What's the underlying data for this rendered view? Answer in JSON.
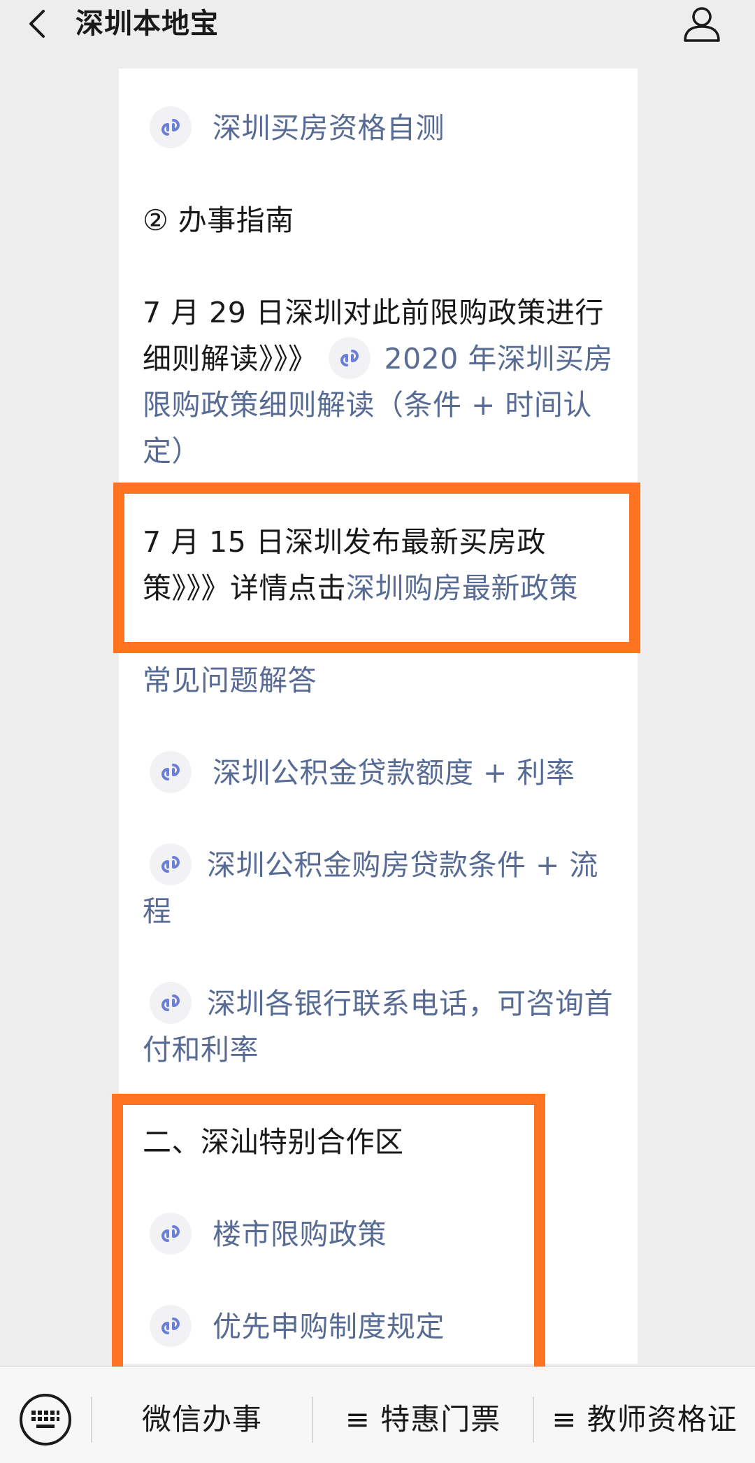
{
  "navbar": {
    "title": "深圳本地宝",
    "back_icon": "back-chevron-icon",
    "profile_icon": "profile-icon"
  },
  "article": {
    "link_qualification": "深圳买房资格自测",
    "section_guide": "② 办事指南",
    "para_0729_text": "7 月 29 日深圳对此前限购政策进行细则解读》》》",
    "para_0729_link": "2020 年深圳买房限购政策细则解读（条件 + 时间认定）",
    "para_0715_text": "7 月 15 日深圳发布最新买房政策》》》详情点击",
    "para_0715_link": "深圳购房最新政策",
    "faq": "常见问题解答",
    "link_fund_quota": "深圳公积金贷款额度 + 利率",
    "link_fund_conditions": "深圳公积金购房贷款条件 + 流程",
    "link_banks": "深圳各银行联系电话，可咨询首付和利率",
    "section_shenshan": "二、深汕特别合作区",
    "link_purchase_policy": "楼市限购政策",
    "link_priority": "优先申购制度规定"
  },
  "bottom_menu": {
    "keyboard_icon": "keyboard-icon",
    "items": [
      "微信办事",
      "≡ 特惠门票",
      "≡ 教师资格证"
    ]
  },
  "colors": {
    "link": "#576b95",
    "highlight": "#ff7320",
    "background": "#ededed"
  }
}
